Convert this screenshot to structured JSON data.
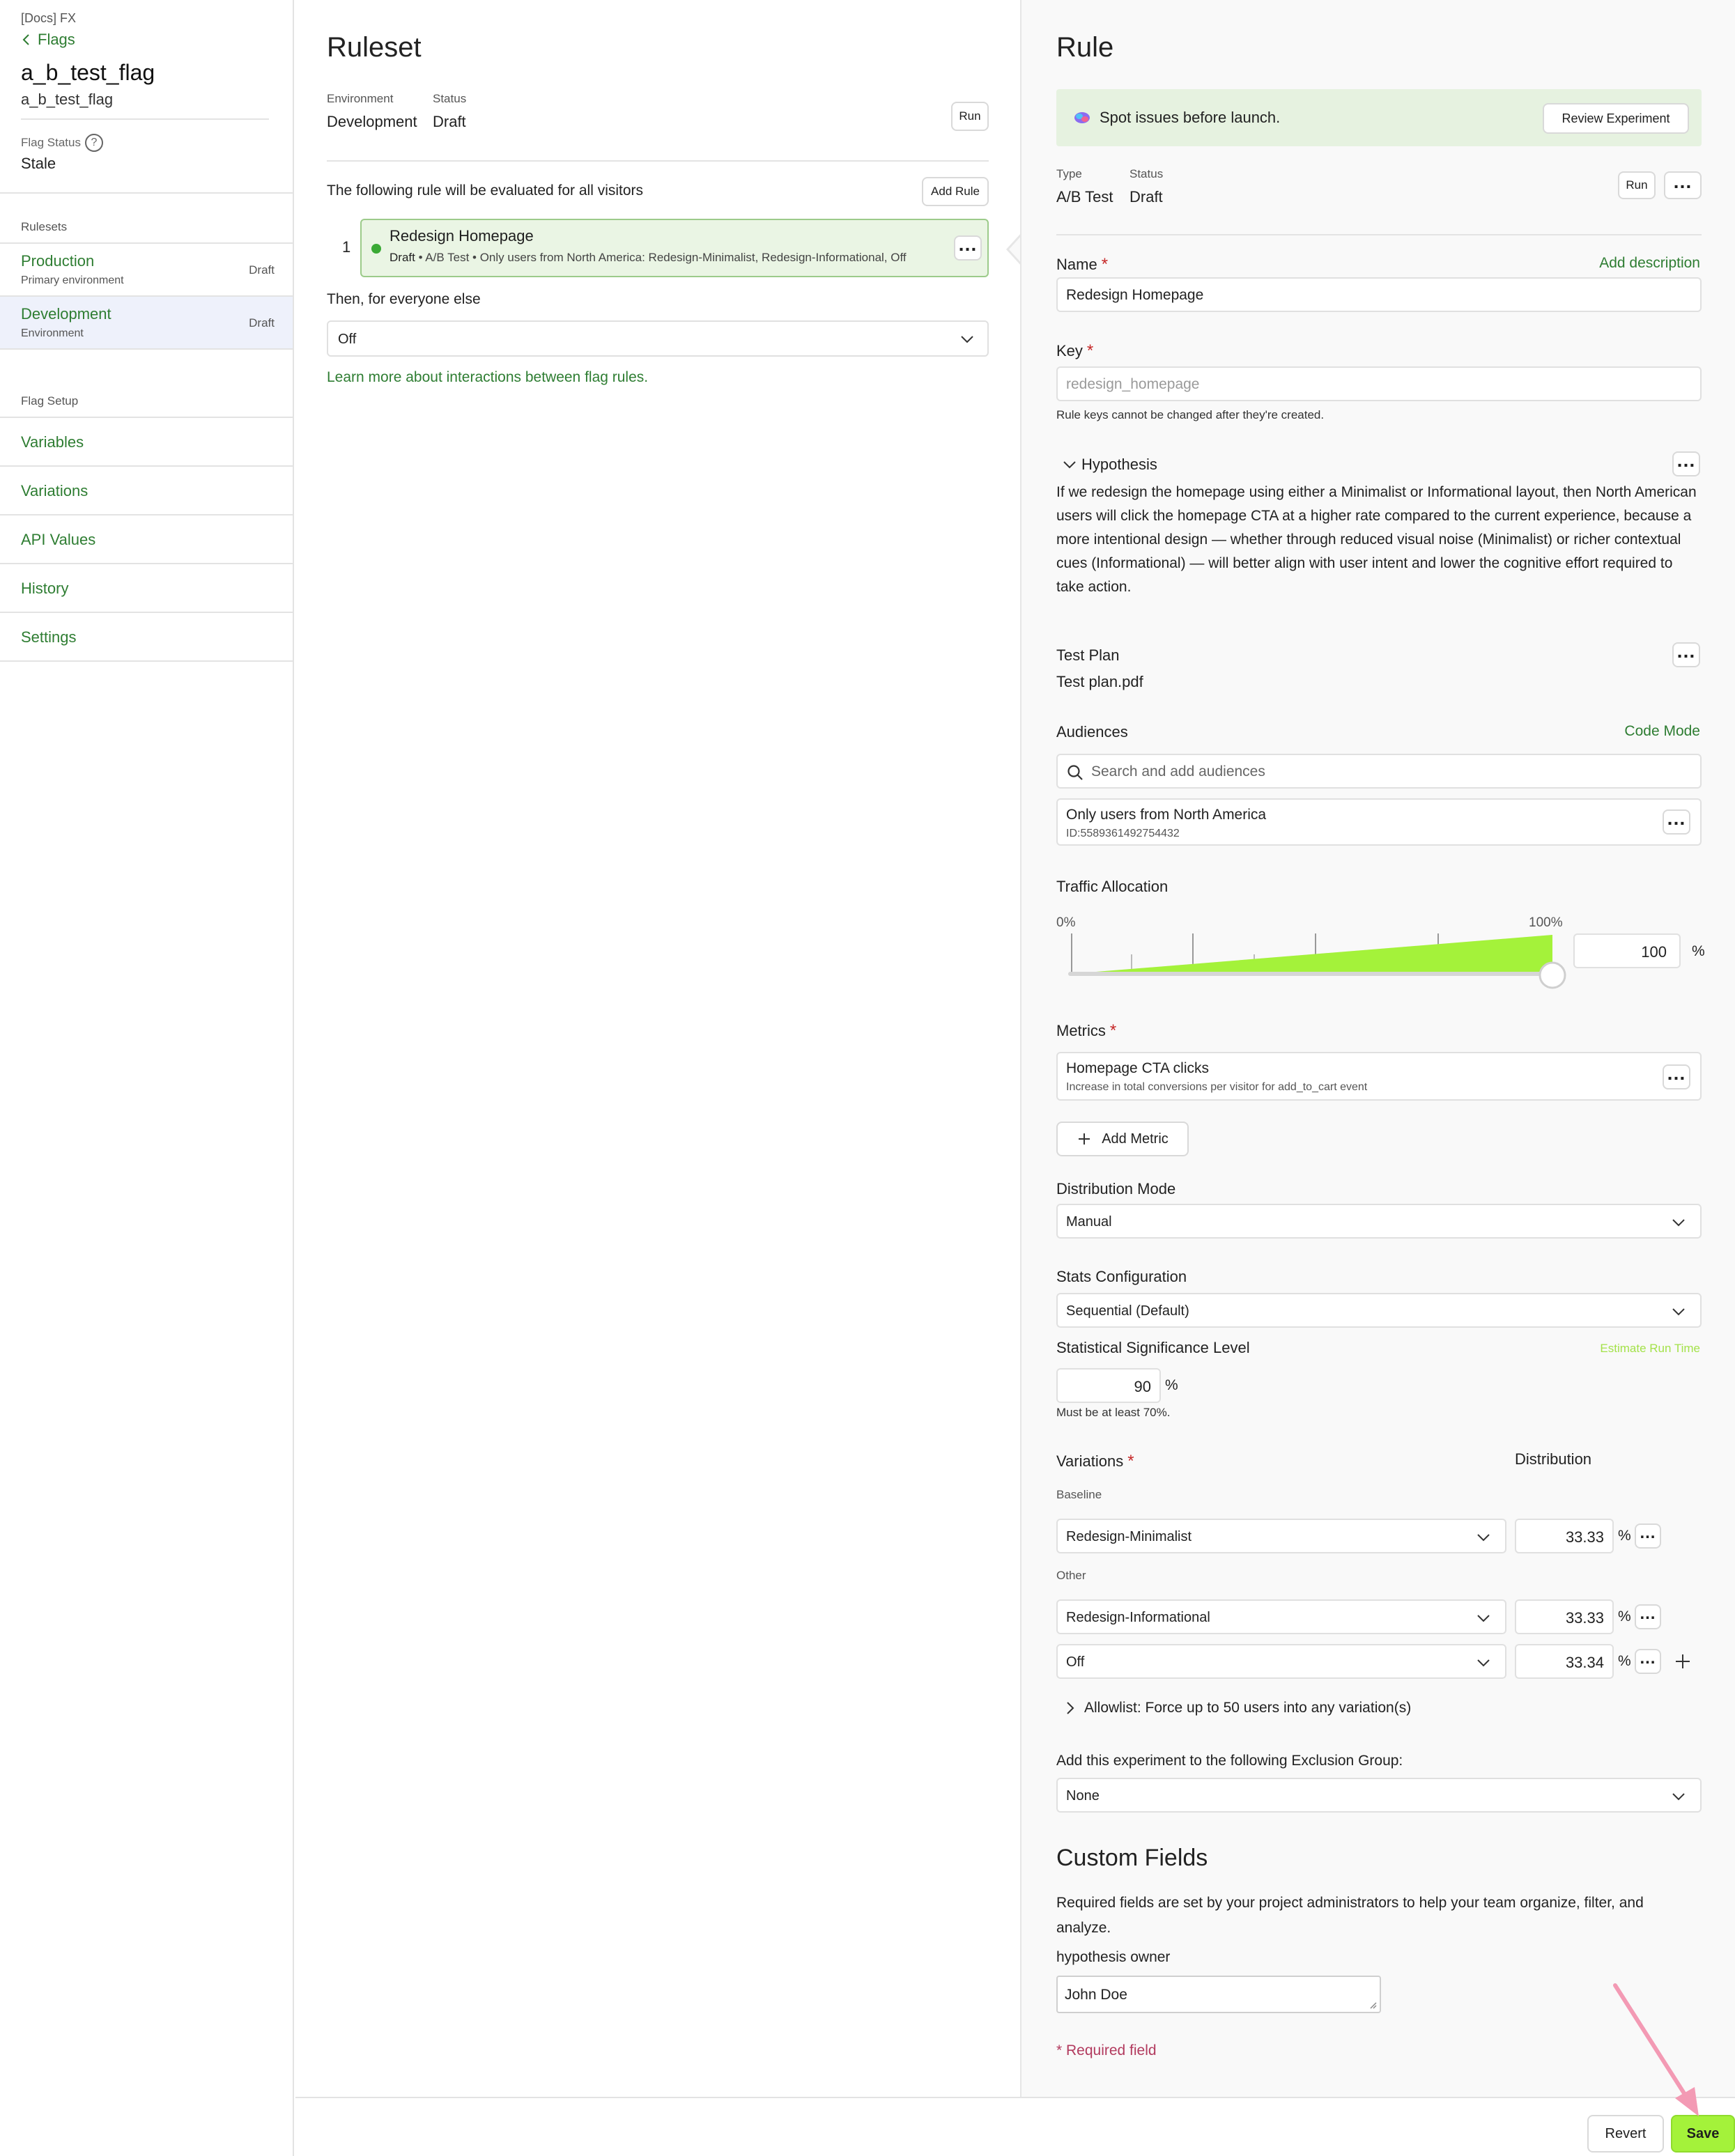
{
  "colors": {
    "accent_green": "#2e7d32",
    "save_button": "#a4f23a",
    "rule_card_bg": "#eaf5e4",
    "traffic_fill": "#a4f23a",
    "required": "#c62828",
    "annotation_arrow": "#f39ab4"
  },
  "sidebar": {
    "project": "[Docs] FX",
    "back_label": "Flags",
    "flag_name": "a_b_test_flag",
    "flag_key": "a_b_test_flag",
    "flag_status_label": "Flag Status",
    "flag_status_value": "Stale",
    "rulesets_heading": "Rulesets",
    "environments": [
      {
        "name": "Production",
        "subtitle": "Primary environment",
        "badge": "Draft"
      },
      {
        "name": "Development",
        "subtitle": "Environment",
        "badge": "Draft"
      }
    ],
    "flag_setup_heading": "Flag Setup",
    "setup_links": [
      "Variables",
      "Variations",
      "API Values",
      "History",
      "Settings"
    ]
  },
  "ruleset": {
    "title": "Ruleset",
    "environment_label": "Environment",
    "environment_value": "Development",
    "status_label": "Status",
    "status_value": "Draft",
    "run_label": "Run",
    "evaluation_text": "The following rule will be evaluated for all visitors",
    "add_rule_label": "Add Rule",
    "rule_number": "1",
    "rule_title": "Redesign Homepage",
    "rule_status": "Draft",
    "rule_summary": " • A/B Test • Only users from North America: Redesign-Minimalist, Redesign-Informational, Off",
    "then_label": "Then, for everyone else",
    "fallback_value": "Off",
    "learn_more": "Learn more about interactions between flag rules."
  },
  "rule": {
    "title": "Rule",
    "banner_text": "Spot issues before launch.",
    "review_button": "Review Experiment",
    "type_label": "Type",
    "type_value": "A/B Test",
    "status_label": "Status",
    "status_value": "Draft",
    "run_label": "Run",
    "name_label": "Name",
    "add_description": "Add description",
    "name_value": "Redesign Homepage",
    "key_label": "Key",
    "key_value": "redesign_homepage",
    "key_help": "Rule keys cannot be changed after they're created.",
    "hypothesis_label": "Hypothesis",
    "hypothesis_text": "If we redesign the homepage using either a Minimalist or Informational layout, then North American users will click the homepage CTA at a higher rate compared to the current experience, because a more intentional design — whether through reduced visual noise (Minimalist) or richer contextual cues (Informational) — will better align with user intent and lower the cognitive effort required to take action.",
    "test_plan_label": "Test Plan",
    "test_plan_value": "Test plan.pdf",
    "audiences_label": "Audiences",
    "code_mode": "Code Mode",
    "audience_search_placeholder": "Search and add audiences",
    "audience_name": "Only users from North America",
    "audience_id": "ID:5589361492754432",
    "traffic_label": "Traffic Allocation",
    "traffic_min_label": "0%",
    "traffic_max_label": "100%",
    "traffic_value": "100",
    "traffic_fraction": 1.0,
    "percent_sign": "%",
    "metrics_label": "Metrics",
    "metric_name": "Homepage CTA clicks",
    "metric_desc": "Increase in total conversions per visitor for add_to_cart event",
    "add_metric": "Add Metric",
    "distribution_mode_label": "Distribution Mode",
    "distribution_mode_value": "Manual",
    "stats_config_label": "Stats Configuration",
    "stats_config_value": "Sequential (Default)",
    "significance_label": "Statistical Significance Level",
    "estimate_run_time": "Estimate Run Time",
    "significance_value": "90",
    "significance_help": "Must be at least 70%.",
    "variations_label": "Variations",
    "distribution_label": "Distribution",
    "baseline_label": "Baseline",
    "other_label": "Other",
    "variations": [
      {
        "name": "Redesign-Minimalist",
        "pct": "33.33"
      },
      {
        "name": "Redesign-Informational",
        "pct": "33.33"
      },
      {
        "name": "Off",
        "pct": "33.34"
      }
    ],
    "allowlist": "Allowlist: Force up to 50 users into any variation(s)",
    "exclusion_label": "Add this experiment to the following Exclusion Group:",
    "exclusion_value": "None",
    "custom_fields_title": "Custom Fields",
    "custom_fields_desc": "Required fields are set by your project administrators to help your team organize, filter, and analyze.",
    "hypothesis_owner_label": "hypothesis owner",
    "hypothesis_owner_value": "John Doe",
    "required_note": "* Required field"
  },
  "footer": {
    "revert": "Revert",
    "save": "Save"
  }
}
